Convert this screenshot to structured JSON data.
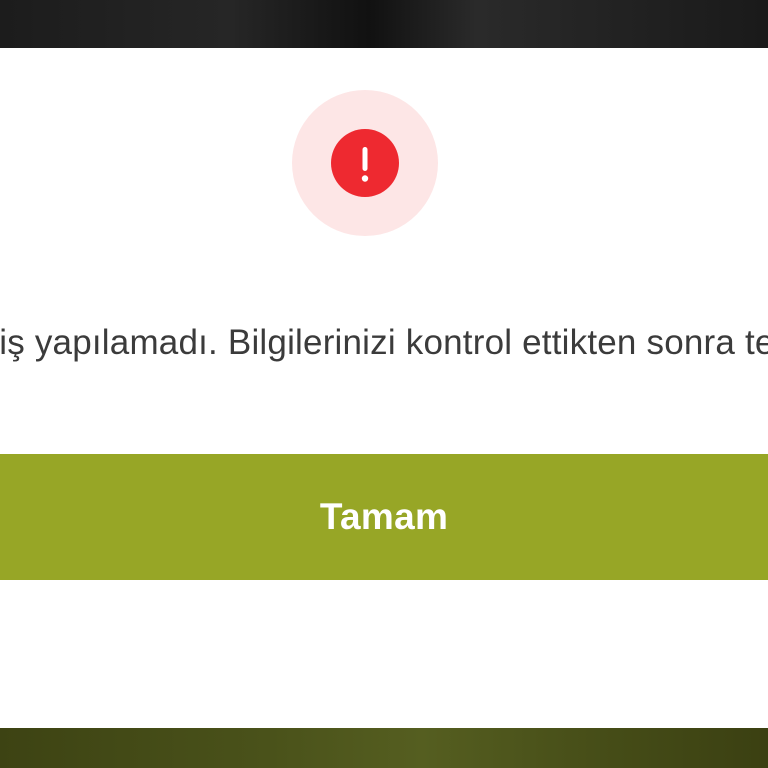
{
  "dialog": {
    "icon": "exclamation-alert-icon",
    "message": "Giriş yapılamadı. Bilgilerinizi kontrol ettikten sonra tekrar deneyin.",
    "confirm_label": "Tamam"
  },
  "colors": {
    "halo": "#fde6e6",
    "alert": "#ee2930",
    "button": "#97a626",
    "button_text": "#ffffff",
    "message_text": "#3b3b3b",
    "surface": "#ffffff"
  }
}
